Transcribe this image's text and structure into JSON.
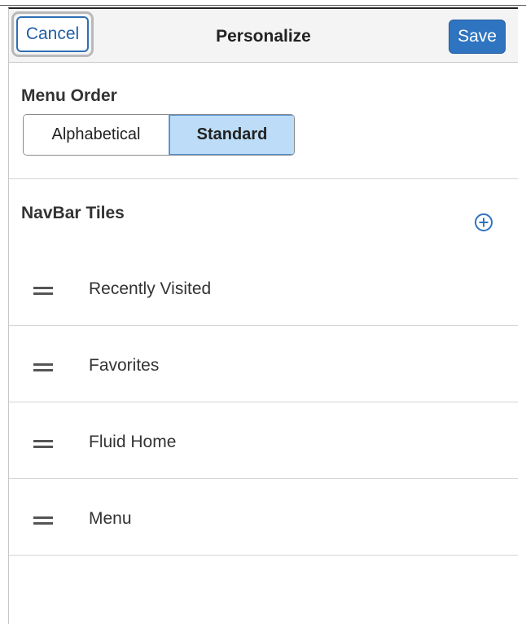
{
  "header": {
    "cancel_label": "Cancel",
    "title": "Personalize",
    "save_label": "Save"
  },
  "menu_order": {
    "label": "Menu Order",
    "options": [
      "Alphabetical",
      "Standard"
    ],
    "selected": "Standard"
  },
  "navbar": {
    "title": "NavBar Tiles",
    "add_icon": "plus-circle-icon",
    "tiles": [
      {
        "label": "Recently Visited",
        "handle_icon": "drag-handle-icon"
      },
      {
        "label": "Favorites",
        "handle_icon": "drag-handle-icon"
      },
      {
        "label": "Fluid Home",
        "handle_icon": "drag-handle-icon"
      },
      {
        "label": "Menu",
        "handle_icon": "drag-handle-icon"
      }
    ]
  },
  "colors": {
    "accent": "#2f74c0",
    "selected_segment": "#bcdcf8",
    "header_bg": "#f4f4f4"
  }
}
